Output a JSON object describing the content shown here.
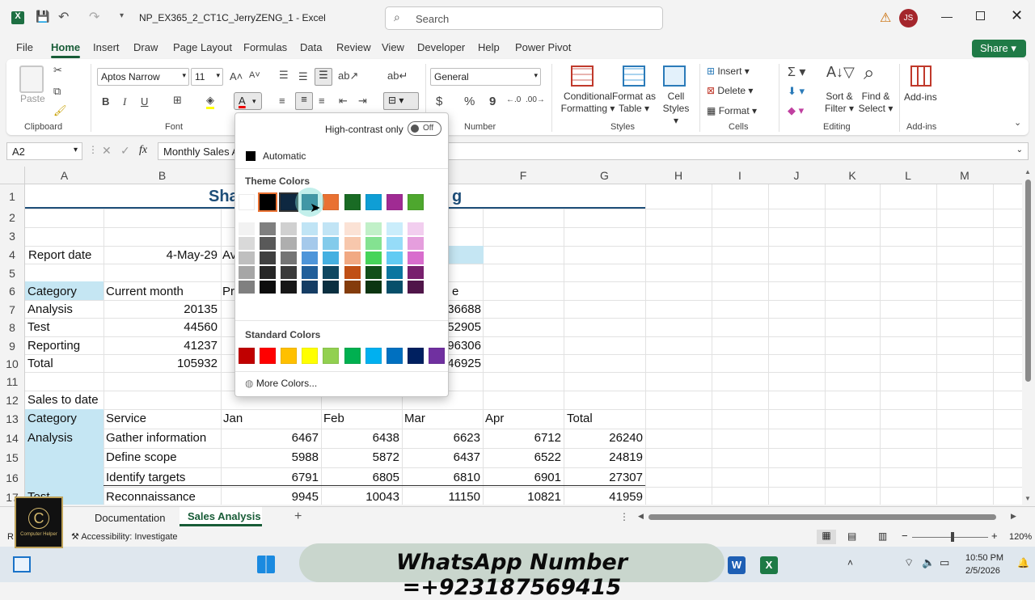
{
  "titlebar": {
    "filename": "NP_EX365_2_CT1C_JerryZENG_1",
    "sep": "-",
    "app": "Excel",
    "search_placeholder": "Search",
    "avatar": "JS",
    "warning": "⚠"
  },
  "tabs": [
    "File",
    "Home",
    "Insert",
    "Draw",
    "Page Layout",
    "Formulas",
    "Data",
    "Review",
    "View",
    "Developer",
    "Help",
    "Power Pivot"
  ],
  "share": "Share",
  "ribbon": {
    "clipboard": {
      "paste": "Paste",
      "label": "Clipboard"
    },
    "font": {
      "name": "Aptos Narrow",
      "size": "11",
      "bold": "B",
      "italic": "I",
      "underline": "U",
      "label": "Font"
    },
    "number": {
      "format": "General",
      "label": "Number",
      "currency": "$",
      "percent": "%",
      "comma": "9"
    },
    "styles": {
      "cond": "Conditional",
      "cond2": "Formatting",
      "fmt_table": "Format as",
      "fmt_table2": "Table",
      "cell_styles": "Cell",
      "cell_styles2": "Styles",
      "label": "Styles"
    },
    "cells": {
      "insert": "Insert",
      "delete": "Delete",
      "format": "Format",
      "label": "Cells"
    },
    "editing": {
      "sort": "Sort &",
      "sort2": "Filter",
      "find": "Find &",
      "find2": "Select",
      "label": "Editing"
    },
    "addins": {
      "addins": "Add-ins",
      "label": "Add-ins"
    }
  },
  "formula_bar": {
    "namebox": "A2",
    "fx": "fx",
    "content": "Monthly Sales A"
  },
  "columns": [
    "A",
    "B",
    "C",
    "D",
    "E",
    "F",
    "G",
    "H",
    "I",
    "J",
    "K",
    "L",
    "M"
  ],
  "rows": [
    "1",
    "2",
    "3",
    "4",
    "5",
    "6",
    "7",
    "8",
    "9",
    "10",
    "11",
    "12",
    "13",
    "14",
    "15",
    "16",
    "17"
  ],
  "cells": {
    "title_left": "Sha",
    "title_right": "g",
    "report_date_label": "Report date",
    "report_date": "4-May-29",
    "c4": "Av",
    "cat_hdr": "Category",
    "cur_month": "Current month",
    "c6": "Pr",
    "e6": "e",
    "r7a": "Analysis",
    "r7b": "20135",
    "r7e": "36688",
    "r8a": "Test",
    "r8b": "44560",
    "r8e": "52905",
    "r9a": "Reporting",
    "r9b": "41237",
    "r9e": "96306",
    "r10a": "Total",
    "r10b": "105932",
    "r10e": "46925",
    "r12a": "Sales to date",
    "r13": [
      "Category",
      "Service",
      "Jan",
      "Feb",
      "Mar",
      "Apr",
      "Total"
    ],
    "r14": [
      "Analysis",
      "Gather information",
      "6467",
      "6438",
      "6623",
      "6712",
      "26240"
    ],
    "r15": [
      "",
      "Define scope",
      "5988",
      "5872",
      "6437",
      "6522",
      "24819"
    ],
    "r16": [
      "",
      "Identify targets",
      "6791",
      "6805",
      "6810",
      "6901",
      "27307"
    ],
    "r17": [
      "Test",
      "Reconnaissance",
      "9945",
      "10043",
      "11150",
      "10821",
      "41959"
    ]
  },
  "sheet_tabs": {
    "doc": "Documentation",
    "sales": "Sales Analysis",
    "add": "+"
  },
  "status": {
    "accessibility": "Accessibility: Investigate",
    "zoom": "120%",
    "ready": "R"
  },
  "taskbar": {
    "time": "10:50 PM",
    "date": "2/5/2026"
  },
  "watermark": "WhatsApp Number =+923187569415",
  "logo": {
    "letter": "C",
    "text": "Computer Helper"
  },
  "color_popup": {
    "high_contrast": "High-contrast only",
    "toggle": "Off",
    "automatic": "Automatic",
    "theme_title": "Theme Colors",
    "standard_title": "Standard Colors",
    "more": "More Colors...",
    "theme_top": [
      "#ffffff",
      "#000000",
      "#0e2841",
      "#156082",
      "#e97132",
      "#196b24",
      "#0f9ed5",
      "#a02b93",
      "#4ea72e"
    ],
    "theme_shades": [
      [
        "#f2f2f2",
        "#7f7f7f",
        "#d0d0d0",
        "#c0e4f5",
        "#c1e4f5",
        "#fbe2d5",
        "#c1f0c8",
        "#caedfb",
        "#f2ceef"
      ],
      [
        "#d9d9d9",
        "#595959",
        "#aeaeae",
        "#a5c9eb",
        "#83cbeb",
        "#f7c7ac",
        "#84e291",
        "#96dcf8",
        "#e59edd"
      ],
      [
        "#bfbfbf",
        "#404040",
        "#757575",
        "#4e95d9",
        "#45b0e1",
        "#f1a983",
        "#47d45a",
        "#61cbf3",
        "#d86dcd"
      ],
      [
        "#a6a6a6",
        "#262626",
        "#3a3a3a",
        "#215f9a",
        "#0f4761",
        "#c04f15",
        "#124f1a",
        "#0b76a0",
        "#78206e"
      ],
      [
        "#808080",
        "#0d0d0d",
        "#171717",
        "#153d64",
        "#0a2f40",
        "#843c0c",
        "#0c3511",
        "#074f6a",
        "#501549"
      ]
    ],
    "standard": [
      "#c00000",
      "#ff0000",
      "#ffc000",
      "#ffff00",
      "#92d050",
      "#00b050",
      "#00b0f0",
      "#0070c0",
      "#002060",
      "#7030a0"
    ]
  }
}
